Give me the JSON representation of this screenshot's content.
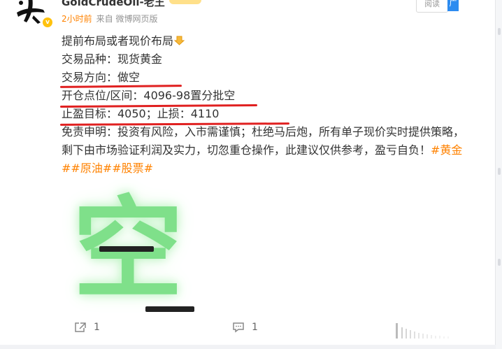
{
  "post": {
    "author": "GoldCrudeOil-老王",
    "time_ago": "2小时前",
    "source": "来自 微博网页版",
    "read_button": "阅读",
    "ad_badge": "广",
    "lines": {
      "intro": "提前布局或者现价布局",
      "variety": "交易品种：现货黄金",
      "direction": "交易方向：做空",
      "entry": "开仓点位/区间：4096-98置分批空",
      "target": "止盈目标：4050；止损：4110",
      "disclaimer_1": "免责申明：投资有风险，入市需谨慎；杜绝马后炮，所有单子现价实时提供策略，",
      "disclaimer_2": "剩下由市场验证利润及实力，切忽重仓操作，此建议仅供参考，盈亏自负！",
      "tag_gold": "#黄金",
      "tags_rest": "##原油##股票#"
    },
    "image": {
      "character": "空",
      "accent_color": "#7fe08a"
    }
  },
  "actions": {
    "share_count": "1",
    "comment_count": "1"
  },
  "colors": {
    "tag": "#ff8200",
    "underline": "#e02020",
    "time": "#ff8200"
  }
}
